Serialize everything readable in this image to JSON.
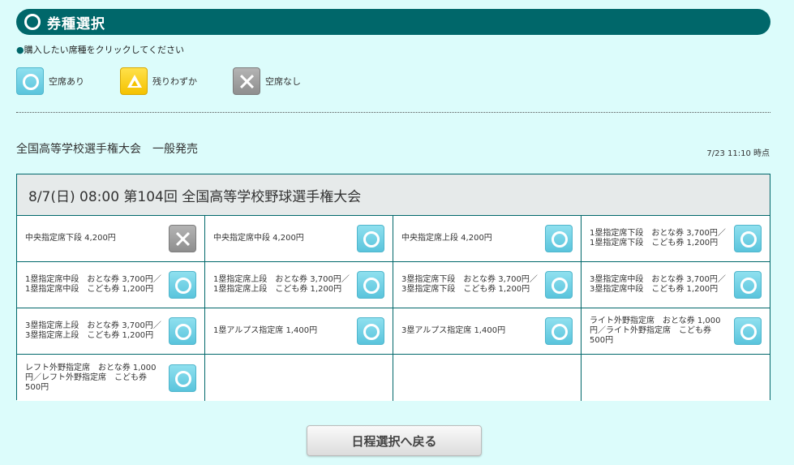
{
  "header": {
    "title": "券種選択"
  },
  "instruction": "購入したい席種をクリックしてください",
  "legend": [
    {
      "icon": "circle-icon",
      "label": "空席あり"
    },
    {
      "icon": "triangle-icon",
      "label": "残りわずか"
    },
    {
      "icon": "cross-icon",
      "label": "空席なし"
    }
  ],
  "event": {
    "title": "全国高等学校選手権大会　一般発売",
    "timestamp": "7/23 11:10 時点"
  },
  "performance": {
    "heading": "8/7(日) 08:00 第104回 全国高等学校野球選手権大会"
  },
  "seats": [
    {
      "name": "中央指定席下段 4,200円",
      "status": "sold-out"
    },
    {
      "name": "中央指定席中段 4,200円",
      "status": "available"
    },
    {
      "name": "中央指定席上段 4,200円",
      "status": "available"
    },
    {
      "name": "1塁指定席下段　おとな券 3,700円／1塁指定席下段　こども券 1,200円",
      "status": "available"
    },
    {
      "name": "1塁指定席中段　おとな券 3,700円／1塁指定席中段　こども券 1,200円",
      "status": "available"
    },
    {
      "name": "1塁指定席上段　おとな券 3,700円／1塁指定席上段　こども券 1,200円",
      "status": "available"
    },
    {
      "name": "3塁指定席下段　おとな券 3,700円／3塁指定席下段　こども券 1,200円",
      "status": "available"
    },
    {
      "name": "3塁指定席中段　おとな券 3,700円／3塁指定席中段　こども券 1,200円",
      "status": "available"
    },
    {
      "name": "3塁指定席上段　おとな券 3,700円／3塁指定席上段　こども券 1,200円",
      "status": "available"
    },
    {
      "name": "1塁アルプス指定席 1,400円",
      "status": "available"
    },
    {
      "name": "3塁アルプス指定席 1,400円",
      "status": "available"
    },
    {
      "name": "ライト外野指定席　おとな券 1,000円／ライト外野指定席　こども券 500円",
      "status": "available"
    },
    {
      "name": "レフト外野指定席　おとな券 1,000円／レフト外野指定席　こども券 500円",
      "status": "available"
    }
  ],
  "back_button": "日程選択へ戻る",
  "colors": {
    "accent": "#00676a",
    "background": "#dcfcfb",
    "available": "#5ac4dc",
    "few": "#f4c200",
    "sold_out": "#8e8e8e"
  }
}
